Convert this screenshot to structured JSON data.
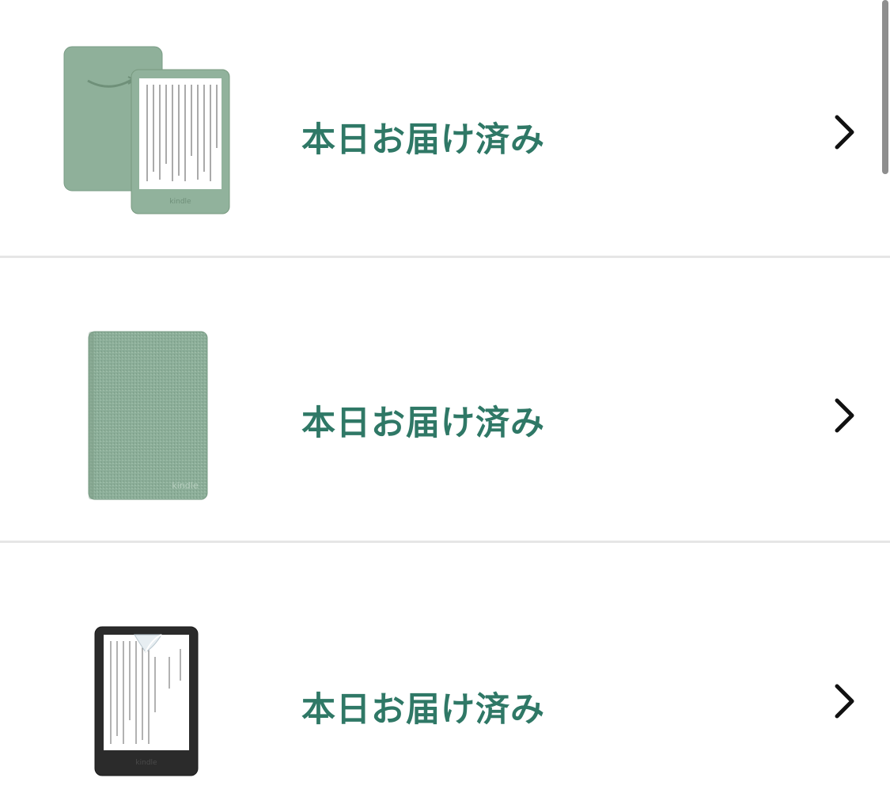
{
  "orders": [
    {
      "status": "本日お届け済み",
      "product_icon": "kindle-green-device-icon",
      "device_brand_label": "kindle"
    },
    {
      "status": "本日お届け済み",
      "product_icon": "kindle-green-cover-icon",
      "device_brand_label": "kindle"
    },
    {
      "status": "本日お届け済み",
      "product_icon": "kindle-black-with-screen-protector-icon",
      "device_brand_label": "kindle"
    }
  ],
  "colors": {
    "status_green": "#2f7866",
    "sage_green": "#8fb09a",
    "sage_dark": "#7a9c86",
    "black_device": "#2b2b2b",
    "divider": "#e6e6e6",
    "chevron": "#111111"
  },
  "chevron_icon": "chevron-right-icon"
}
